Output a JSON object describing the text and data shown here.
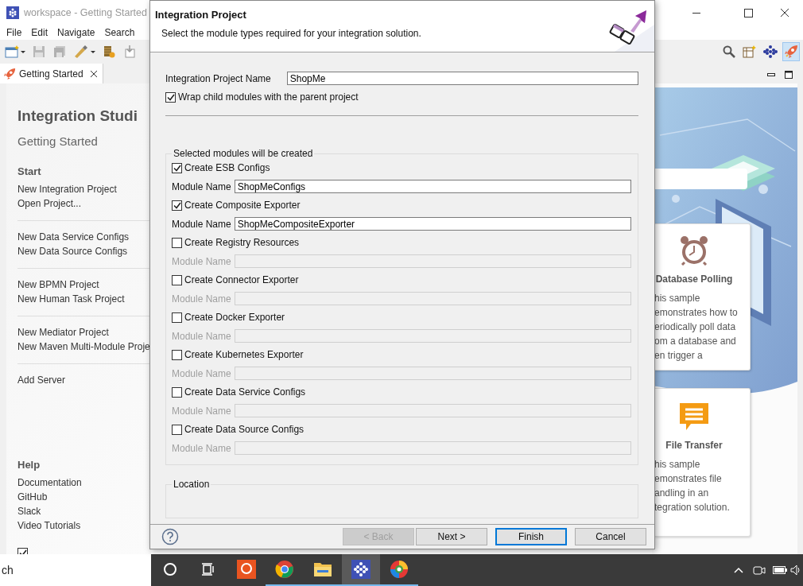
{
  "window": {
    "title": "workspace - Getting Started"
  },
  "menu": [
    "File",
    "Edit",
    "Navigate",
    "Search"
  ],
  "editor_tab": {
    "label": "Getting Started",
    "selected": true
  },
  "welcome": {
    "title": "Integration Studi",
    "subtitle": "Getting Started",
    "sections": [
      {
        "heading": "Start",
        "groups": [
          [
            "New Integration Project",
            "Open Project..."
          ],
          [
            "New Data Service Configs",
            "New Data Source Configs"
          ],
          [
            "New BPMN Project",
            "New Human Task Project"
          ],
          [
            "New Mediator Project",
            "New Maven Multi-Module Proje"
          ],
          [
            "Add Server"
          ]
        ]
      },
      {
        "heading": "Help",
        "groups": [
          [
            "Documentation",
            "GitHub",
            "Slack",
            "Video Tutorials"
          ]
        ]
      }
    ],
    "show_on_startup": {
      "checked": true
    }
  },
  "samples": [
    {
      "kind": "alarm",
      "title": "Database Polling",
      "text": "his sample\nemonstrates how to\neriodically poll data\nom a database and\nen trigger a"
    },
    {
      "kind": "message",
      "title": "File Transfer",
      "text": "his sample\nemonstrates file\nandling in an\ntegration solution."
    }
  ],
  "dialog": {
    "title": "Integration Project",
    "subtitle": "Select the module types required for your integration solution.",
    "project_name_label": "Integration Project Name",
    "project_name": "ShopMe",
    "wrap": {
      "label": "Wrap child modules with the parent project",
      "checked": true
    },
    "modules_group": "Selected modules will be created",
    "modules": [
      {
        "label": "Create ESB Configs",
        "checked": true,
        "field_label": "Module Name",
        "value": "ShopMeConfigs"
      },
      {
        "label": "Create Composite Exporter",
        "checked": true,
        "field_label": "Module Name",
        "value": "ShopMeCompositeExporter"
      },
      {
        "label": "Create Registry Resources",
        "checked": false,
        "field_label": "Module Name"
      },
      {
        "label": "Create Connector Exporter",
        "checked": false,
        "field_label": "Module Name"
      },
      {
        "label": "Create Docker Exporter",
        "checked": false,
        "field_label": "Module Name"
      },
      {
        "label": "Create Kubernetes Exporter",
        "checked": false,
        "field_label": "Module Name"
      },
      {
        "label": "Create Data Service Configs",
        "checked": false,
        "field_label": "Module Name"
      },
      {
        "label": "Create Data Source Configs",
        "checked": false,
        "field_label": "Module Name"
      }
    ],
    "location_group": "Location",
    "buttons": [
      {
        "label": "< Back",
        "disabled": true,
        "default": false
      },
      {
        "label": "Next >",
        "disabled": false,
        "default": false
      },
      {
        "label": "Finish",
        "disabled": false,
        "default": true
      },
      {
        "label": "Cancel",
        "disabled": false,
        "default": false
      }
    ]
  },
  "taskbar": {
    "search": "ch",
    "apps": [
      {
        "kind": "ring",
        "running": false,
        "selected": false
      },
      {
        "kind": "browser",
        "running": true,
        "selected": false
      },
      {
        "kind": "folder",
        "running": true,
        "selected": false
      },
      {
        "kind": "dots",
        "running": true,
        "selected": true
      },
      {
        "kind": "swirl",
        "running": true,
        "selected": false
      }
    ]
  }
}
